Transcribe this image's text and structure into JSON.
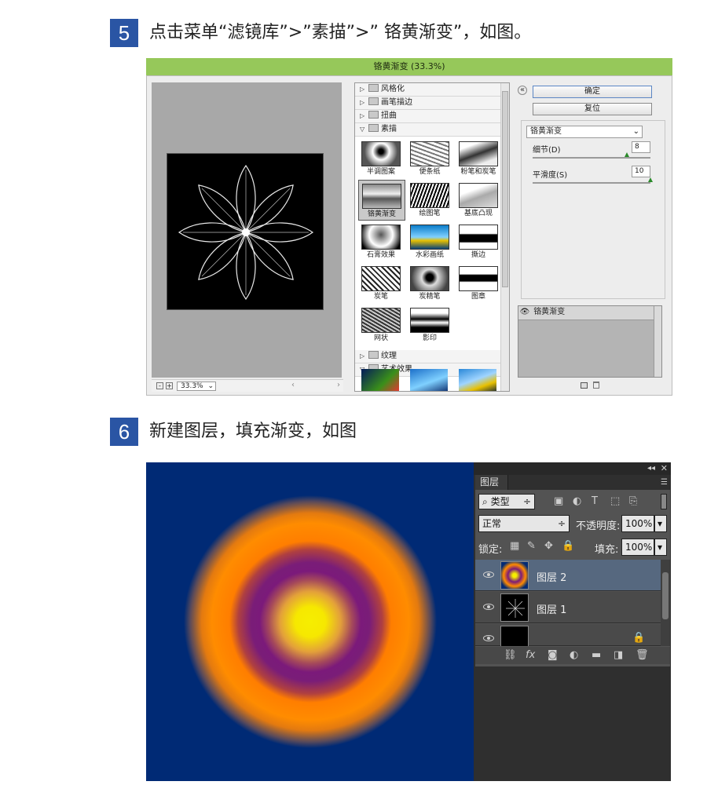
{
  "step5": {
    "number": "5",
    "text": "点击菜单“滤镜库”>”素描”>” 铬黄渐变”，如图。"
  },
  "filter_gallery": {
    "title": "铬黄渐变 (33.3%)",
    "zoom": "33.3%",
    "categories_top": [
      "风格化",
      "画笔描边",
      "扭曲",
      "素描"
    ],
    "sketch_filters": [
      {
        "label": "半调图案"
      },
      {
        "label": "便条纸"
      },
      {
        "label": "粉笔和炭笔"
      },
      {
        "label": "铬黄渐变"
      },
      {
        "label": "绘图笔"
      },
      {
        "label": "基底凸现"
      },
      {
        "label": "石膏效果"
      },
      {
        "label": "水彩画纸"
      },
      {
        "label": "撕边"
      },
      {
        "label": "炭笔"
      },
      {
        "label": "炭精笔"
      },
      {
        "label": "图章"
      },
      {
        "label": "网状"
      },
      {
        "label": "影印"
      }
    ],
    "categories_bottom": [
      "纹理",
      "艺术效果"
    ],
    "ok_label": "确定",
    "reset_label": "复位",
    "selected_filter": "铬黄渐变",
    "params": [
      {
        "label": "细节(D)",
        "value": "8",
        "level": 0.8
      },
      {
        "label": "平滑度(S)",
        "value": "10",
        "level": 1.0
      }
    ],
    "effect_layer": "铬黄渐变"
  },
  "step6": {
    "number": "6",
    "text": "新建图层，填充渐变，如图"
  },
  "layers_panel": {
    "tab": "图层",
    "filter_kind": "类型",
    "blend_mode": "正常",
    "opacity_label": "不透明度:",
    "opacity_value": "100%",
    "lock_label": "锁定:",
    "fill_label": "填充:",
    "fill_value": "100%",
    "layers": [
      {
        "name": "图层 2",
        "active": true
      },
      {
        "name": "图层 1",
        "active": false
      }
    ],
    "colors": {
      "canvas_bg": "#002a75",
      "ring_outer": "#ff8c00",
      "ring_mid": "#7b1a7a",
      "center": "#f6ee00"
    }
  }
}
